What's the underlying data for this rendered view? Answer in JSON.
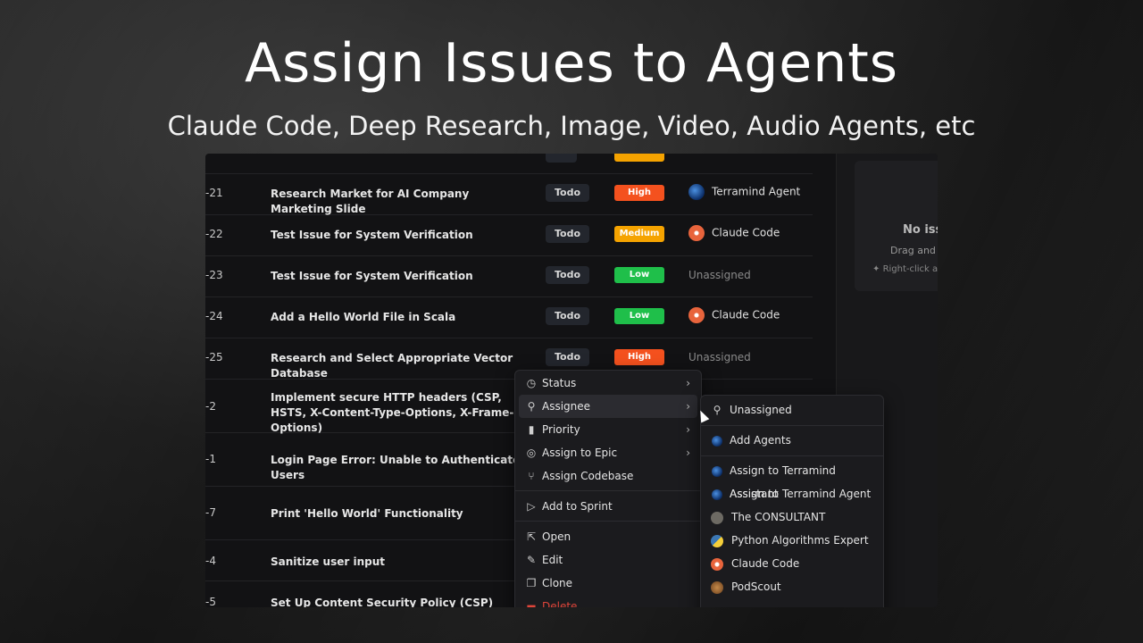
{
  "headline": "Assign Issues to Agents",
  "subline": "Claude Code, Deep Research, Image, Video, Audio Agents, etc",
  "rows": [
    {
      "id": "-21",
      "title": "Research Market for AI Company Marketing Slide",
      "status": "Todo",
      "priority": "High",
      "priority_color": "#f4511e",
      "assignee": "Terramind Agent",
      "avatar": "terramind-avatar-icon"
    },
    {
      "id": "-22",
      "title": "Test Issue for System Verification",
      "status": "Todo",
      "priority": "Medium",
      "priority_color": "#f5a300",
      "assignee": "Claude Code",
      "avatar": "claude-avatar-icon"
    },
    {
      "id": "-23",
      "title": "Test Issue for System Verification",
      "status": "Todo",
      "priority": "Low",
      "priority_color": "#1fbf4a",
      "assignee": "Unassigned",
      "avatar": ""
    },
    {
      "id": "-24",
      "title": "Add a Hello World File in Scala",
      "status": "Todo",
      "priority": "Low",
      "priority_color": "#1fbf4a",
      "assignee": "Claude Code",
      "avatar": "claude-avatar-icon"
    },
    {
      "id": "-25",
      "title": "Research and Select Appropriate Vector Database",
      "status": "Todo",
      "priority": "High",
      "priority_color": "#f4511e",
      "assignee": "Unassigned",
      "avatar": ""
    },
    {
      "id": "-2",
      "title": "Implement secure HTTP headers (CSP, HSTS, X-Content-Type-Options, X-Frame-Options)"
    },
    {
      "id": "-1",
      "title": "Login Page Error: Unable to Authenticate Users"
    },
    {
      "id": "-7",
      "title": "Print 'Hello World' Functionality"
    },
    {
      "id": "-4",
      "title": "Sanitize user input"
    },
    {
      "id": "-5",
      "title": "Set Up Content Security Policy (CSP)"
    }
  ],
  "empty_panel": {
    "title": "No issu",
    "hint": "Drag and d",
    "tip": "Right-click a"
  },
  "context_menu": {
    "status": "Status",
    "assignee": "Assignee",
    "priority": "Priority",
    "assign_epic": "Assign to Epic",
    "assign_codebase": "Assign Codebase",
    "add_sprint": "Add to Sprint",
    "open": "Open",
    "edit": "Edit",
    "clone": "Clone",
    "delete": "Delete"
  },
  "assignee_menu": {
    "unassigned": "Unassigned",
    "add_agents": "Add Agents",
    "items": [
      "Assign to Terramind Assistant",
      "Assign to Terramind Agent",
      "The CONSULTANT",
      "Python Algorithms Expert",
      "Claude Code",
      "PodScout"
    ]
  },
  "colors": {
    "high": "#f4511e",
    "medium": "#f5a300",
    "low": "#1fbf4a",
    "delete": "#e0453a"
  }
}
